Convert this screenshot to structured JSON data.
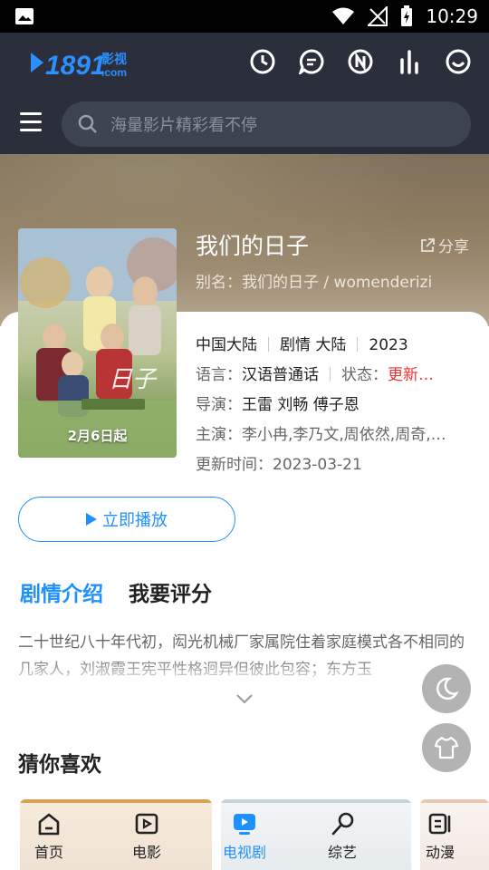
{
  "status_bar": {
    "time": "10:29"
  },
  "header": {
    "logo_text": "1891",
    "logo_cn": "影视",
    "logo_dom": ".com",
    "search_placeholder": "海量影片精彩看不停",
    "icons": [
      "history-icon",
      "message-icon",
      "notice-icon",
      "ranking-icon",
      "smile-icon"
    ]
  },
  "detail": {
    "title": "我们的日子",
    "share_label": "分享",
    "alias": "别名：我们的日子 / womenderizi",
    "region": "中国大陆",
    "genre": "剧情 大陆",
    "year": "2023",
    "language_label": "语言：",
    "language_value": "汉语普通话",
    "status_label": "状态：",
    "status_value": "更新…",
    "director_label": "导演：",
    "director_value": "王雷 刘畅 傅子恩",
    "cast_label": "主演：",
    "cast_value": "李小冉,李乃文,周依然,周奇,…",
    "updated_label": "更新时间：",
    "updated_value": "2023-03-21",
    "poster_date": "2月6日起"
  },
  "play_button_label": "立即播放",
  "tabs": [
    {
      "label": "剧情介绍",
      "active": true
    },
    {
      "label": "我要评分",
      "active": false
    }
  ],
  "synopsis": "二十世纪八十年代初，闳光机械厂家属院住着家庭模式各不相同的几家人，刘淑霞王宪平性格迥异但彼此包容；东方玉",
  "guess_title": "猜你喜欢",
  "bottom_nav": [
    {
      "label": "首页",
      "icon": "home-icon",
      "active": false
    },
    {
      "label": "电影",
      "icon": "film-icon",
      "active": false
    },
    {
      "label": "电视剧",
      "icon": "tv-icon",
      "active": true
    },
    {
      "label": "综艺",
      "icon": "mic-icon",
      "active": false
    },
    {
      "label": "动漫",
      "icon": "anime-icon",
      "active": false
    }
  ],
  "colors": {
    "accent": "#1e90ff",
    "header_bg": "#2a2f3b",
    "status_update": "#e33333"
  }
}
